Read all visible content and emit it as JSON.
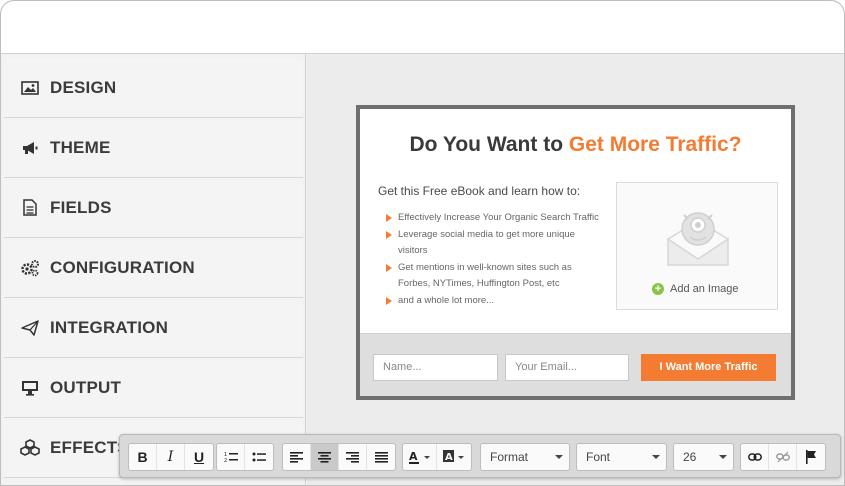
{
  "sidebar": {
    "items": [
      {
        "label": "DESIGN",
        "icon": "image-icon"
      },
      {
        "label": "THEME",
        "icon": "megaphone-icon"
      },
      {
        "label": "FIELDS",
        "icon": "document-icon"
      },
      {
        "label": "CONFIGURATION",
        "icon": "gears-icon"
      },
      {
        "label": "INTEGRATION",
        "icon": "paper-plane-icon"
      },
      {
        "label": "OUTPUT",
        "icon": "monitor-icon"
      },
      {
        "label": "EFFECTS",
        "icon": "cubes-icon"
      }
    ]
  },
  "popup": {
    "title_prefix": "Do You Want to ",
    "title_accent": "Get More Traffic?",
    "subtitle": "Get this Free eBook and learn how to:",
    "bullets": [
      "Effectively Increase Your Organic Search Traffic",
      "Leverage social media to get more unique visitors",
      "Get mentions in well-known sites such as Forbes, NYTimes, Huffington Post, etc",
      "and a whole lot more..."
    ],
    "add_image_label": "Add an Image",
    "name_placeholder": "Name...",
    "email_placeholder": "Your Email...",
    "cta_label": "I Want More Traffic"
  },
  "toolbar": {
    "format_label": "Format",
    "font_label": "Font",
    "size_value": "26"
  },
  "colors": {
    "accent": "#f47b32",
    "popup_border": "#6f6f6f"
  }
}
